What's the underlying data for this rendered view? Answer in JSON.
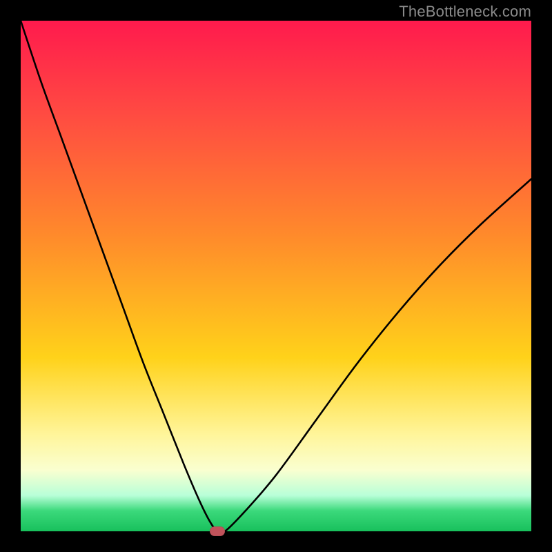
{
  "watermark": "TheBottleneck.com",
  "chart_data": {
    "type": "line",
    "title": "",
    "xlabel": "",
    "ylabel": "",
    "xlim": [
      0,
      100
    ],
    "ylim": [
      0,
      100
    ],
    "grid": false,
    "legend": false,
    "marker": {
      "x": 38.5,
      "y": 0
    },
    "series": [
      {
        "name": "curve",
        "x": [
          0,
          4,
          8,
          12,
          16,
          20,
          24,
          28,
          32,
          35,
          37,
          38.5,
          40,
          44,
          50,
          58,
          66,
          74,
          82,
          90,
          100
        ],
        "y": [
          100,
          88,
          77,
          66,
          55,
          44,
          33,
          23,
          13,
          6,
          2,
          0,
          0,
          4,
          11,
          22,
          33,
          43,
          52,
          60,
          69
        ]
      }
    ],
    "colors": {
      "curve": "#000000",
      "gradient_top": "#ff1a4d",
      "gradient_mid": "#ffd21a",
      "gradient_bottom": "#18c05c",
      "marker": "#c0535b"
    }
  }
}
